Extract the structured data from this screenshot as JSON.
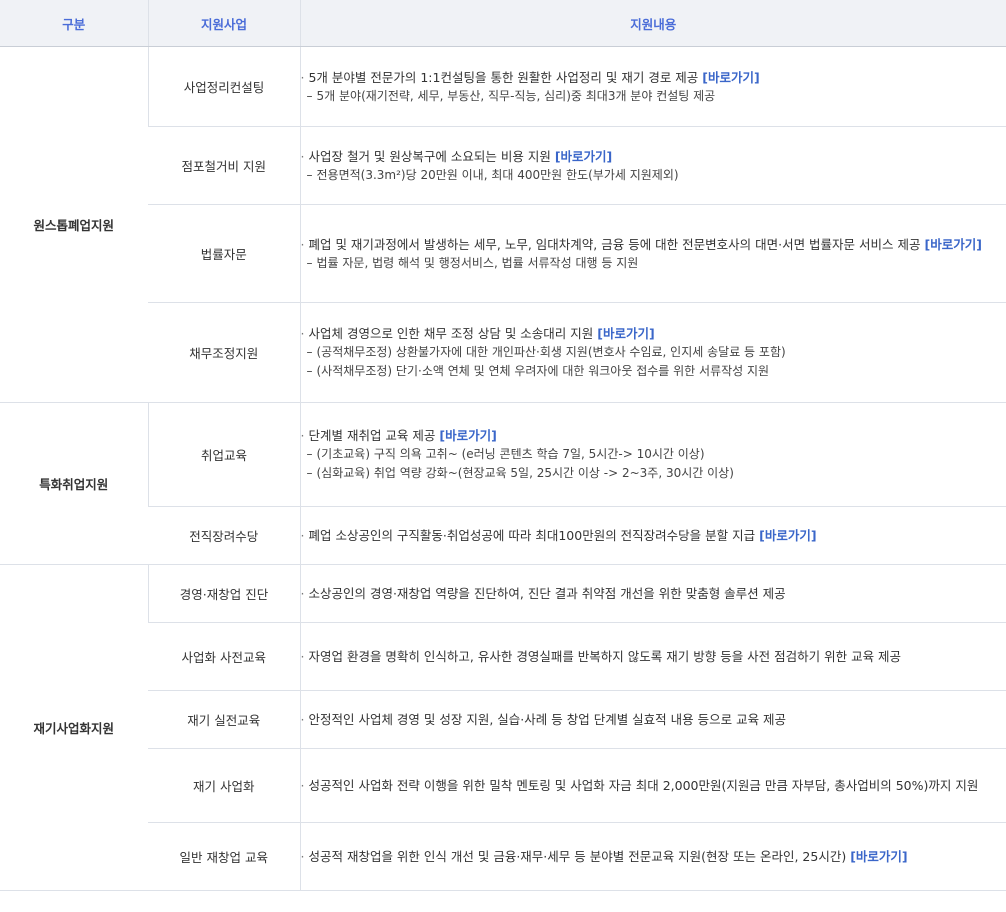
{
  "header": {
    "col1": "구분",
    "col2": "지원사업",
    "col3": "지원내용"
  },
  "link_label": "[바로가기]",
  "groups": [
    {
      "category": "원스톱폐업지원",
      "rows": [
        {
          "program": "사업정리컨설팅",
          "main": "5개 분야별 전문가의 1:1컨설팅을 통한 원활한 사업정리 및 재기 경로 제공",
          "link": "[바로가기]",
          "subs": [
            "5개 분야(재기전략, 세무, 부동산, 직무-직능, 심리)중 최대3개 분야 컨설팅 제공"
          ]
        },
        {
          "program": "점포철거비 지원",
          "main": "사업장 철거 및 원상복구에 소요되는 비용 지원",
          "link": "[바로가기]",
          "subs": [
            "전용면적(3.3m²)당 20만원 이내, 최대 400만원 한도(부가세 지원제외)"
          ]
        },
        {
          "program": "법률자문",
          "main": "폐업 및 재기과정에서 발생하는 세무, 노무, 임대차계약, 금융 등에 대한 전문변호사의 대면·서면 법률자문 서비스 제공",
          "link": "[바로가기]",
          "subs": [
            "법률 자문, 법령 해석 및 행정서비스, 법률 서류작성 대행 등 지원"
          ]
        },
        {
          "program": "채무조정지원",
          "main": "사업체 경영으로 인한 채무 조정 상담 및 소송대리 지원",
          "link": "[바로가기]",
          "subs": [
            "(공적채무조정) 상환불가자에 대한 개인파산·회생 지원(변호사 수임료, 인지세 송달료 등 포함)",
            "(사적채무조정) 단기·소액 연체 및 연체 우려자에 대한 워크아웃 접수를 위한 서류작성 지원"
          ]
        }
      ]
    },
    {
      "category": "특화취업지원",
      "rows": [
        {
          "program": "취업교육",
          "main": "단계별 재취업 교육 제공",
          "link": "[바로가기]",
          "subs": [
            "(기초교육) 구직 의욕 고취~ (e러닝 콘텐츠 학습 7일, 5시간-> 10시간 이상)",
            "(심화교육) 취업 역량 강화~(현장교육 5일, 25시간 이상 -> 2~3주, 30시간 이상)"
          ]
        },
        {
          "program": "전직장려수당",
          "main": "폐업 소상공인의 구직활동·취업성공에 따라 최대100만원의 전직장려수당을 분할 지급",
          "link": "[바로가기]",
          "subs": []
        }
      ]
    },
    {
      "category": "재기사업화지원",
      "rows": [
        {
          "program": "경영·재창업 진단",
          "main": "소상공인의 경영·재창업 역량을 진단하여, 진단 결과 취약점 개선을 위한 맞춤형 솔루션 제공",
          "link": "",
          "subs": []
        },
        {
          "program": "사업화 사전교육",
          "main": "자영업 환경을 명확히 인식하고, 유사한 경영실패를 반복하지 않도록 재기 방향 등을 사전 점검하기 위한 교육 제공",
          "link": "",
          "subs": []
        },
        {
          "program": "재기 실전교육",
          "main": "안정적인 사업체 경영 및 성장 지원, 실습·사례 등 창업 단계별 실효적 내용 등으로 교육 제공",
          "link": "",
          "subs": []
        },
        {
          "program": "재기 사업화",
          "main": "성공적인 사업화 전략 이행을 위한 밀착 멘토링 및 사업화 자금 최대 2,000만원(지원금 만큼 자부담, 총사업비의 50%)까지 지원",
          "link": "",
          "subs": []
        },
        {
          "program": "일반 재창업 교육",
          "main": "성공적 재창업을 위한 인식 개선 및 금융·재무·세무 등 분야별 전문교육 지원(현장 또는 온라인, 25시간)",
          "link": "[바로가기]",
          "subs": []
        }
      ]
    }
  ]
}
